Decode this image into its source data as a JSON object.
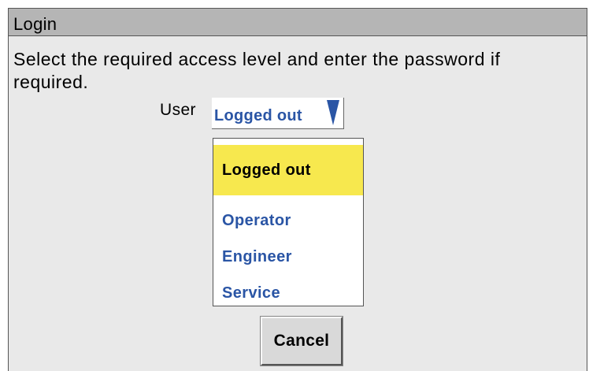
{
  "window": {
    "title": "Login"
  },
  "instructions": "Select the required access level and enter the password if required.",
  "user_field": {
    "label": "User",
    "selected_value": "Logged out",
    "arrow_icon": "triangle-down-icon"
  },
  "dropdown": {
    "options": [
      {
        "label": "Logged out",
        "selected": true
      },
      {
        "label": "Operator",
        "selected": false
      },
      {
        "label": "Engineer",
        "selected": false
      },
      {
        "label": "Service",
        "selected": false
      }
    ]
  },
  "buttons": {
    "cancel_label": "Cancel"
  },
  "colors": {
    "titlebar": "#b5b5b5",
    "background": "#e9e9e9",
    "accent_text": "#2a55a5",
    "highlight": "#f7e84e"
  }
}
